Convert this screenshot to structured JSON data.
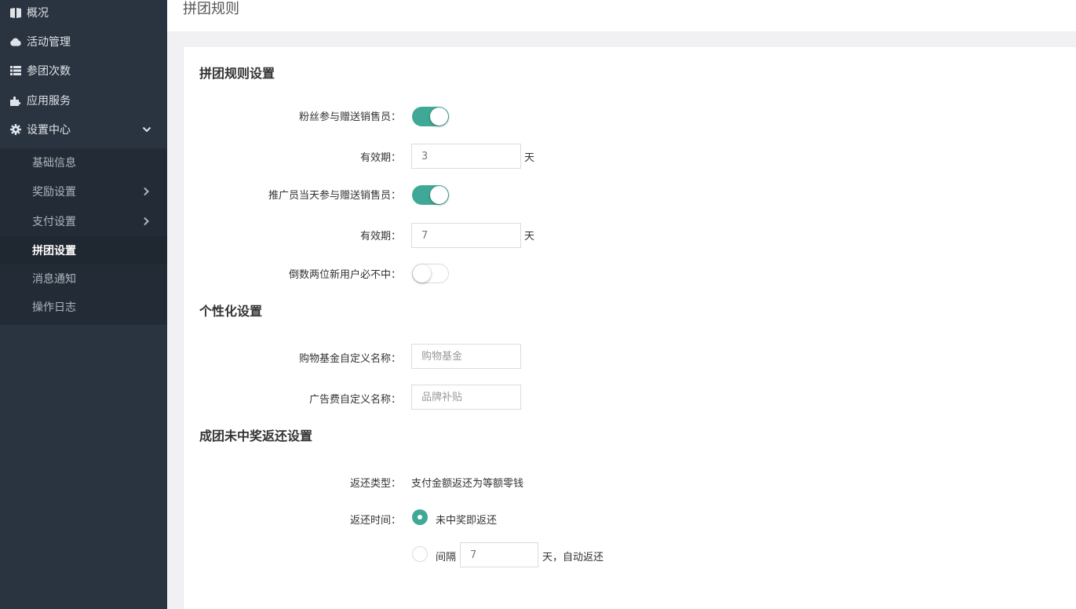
{
  "sidebar": {
    "items": [
      {
        "label": "概况",
        "icon": "book-icon"
      },
      {
        "label": "活动管理",
        "icon": "cloud-icon"
      },
      {
        "label": "参团次数",
        "icon": "list-icon"
      },
      {
        "label": "应用服务",
        "icon": "puzzle-icon"
      },
      {
        "label": "设置中心",
        "icon": "gear-icon",
        "expanded": true
      }
    ],
    "submenu": [
      {
        "label": "基础信息",
        "has_children": false,
        "active": false
      },
      {
        "label": "奖励设置",
        "has_children": true,
        "active": false
      },
      {
        "label": "支付设置",
        "has_children": true,
        "active": false
      },
      {
        "label": "拼团设置",
        "has_children": false,
        "active": true
      },
      {
        "label": "消息通知",
        "has_children": false,
        "active": false
      },
      {
        "label": "操作日志",
        "has_children": false,
        "active": false
      }
    ]
  },
  "header": {
    "title": "拼团规则"
  },
  "rules": {
    "section_title": "拼团规则设置",
    "fan_gift_label": "粉丝参与赠送销售员：",
    "fan_gift_on": true,
    "validity1_label": "有效期：",
    "validity1_value": "3",
    "validity1_unit": "天",
    "promoter_gift_label": "推广员当天参与赠送销售员：",
    "promoter_gift_on": true,
    "validity2_label": "有效期：",
    "validity2_value": "7",
    "validity2_unit": "天",
    "last_two_label": "倒数两位新用户必不中：",
    "last_two_on": false
  },
  "personal": {
    "section_title": "个性化设置",
    "fund_name_label": "购物基金自定义名称：",
    "fund_name_placeholder": "购物基金",
    "ad_fee_label": "广告费自定义名称：",
    "ad_fee_placeholder": "品牌补贴"
  },
  "refund": {
    "section_title": "成团未中奖返还设置",
    "type_label": "返还类型：",
    "type_value": "支付金额返还为等额零钱",
    "time_label": "返还时间：",
    "option_immediate": "未中奖即返还",
    "option_interval_prefix": "间隔",
    "interval_value": "7",
    "option_interval_suffix": "天，自动返还",
    "selected": "immediate"
  },
  "colors": {
    "accent": "#3fa896",
    "sidebar_bg": "#2a3440",
    "submenu_bg": "#232c36"
  }
}
